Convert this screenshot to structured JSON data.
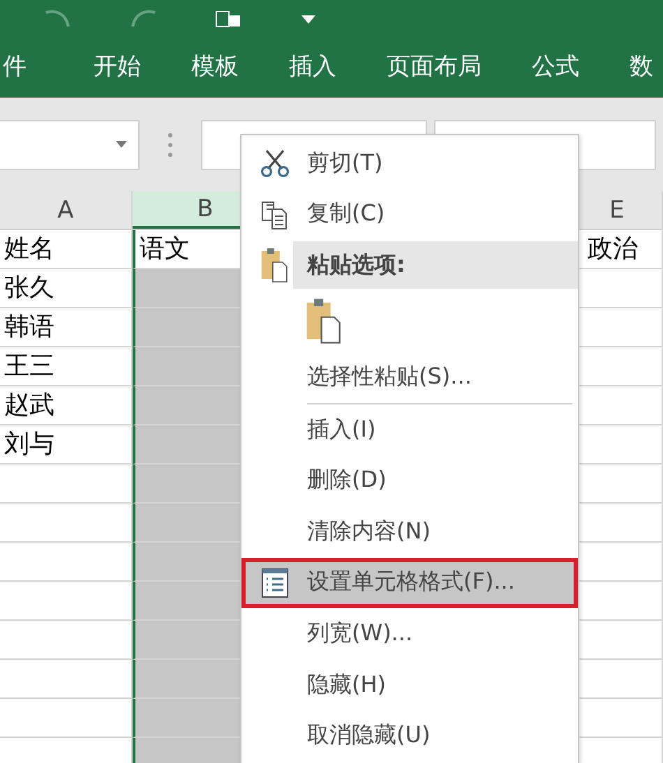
{
  "ribbon_tabs": [
    {
      "label": "件",
      "selected": false
    },
    {
      "label": "开始",
      "selected": false
    },
    {
      "label": "模板",
      "selected": false
    },
    {
      "label": "插入",
      "selected": false
    },
    {
      "label": "页面布局",
      "selected": false
    },
    {
      "label": "公式",
      "selected": false
    },
    {
      "label": "数",
      "selected": false
    }
  ],
  "sheet": {
    "columns": [
      {
        "label": "A",
        "selected": false
      },
      {
        "label": "B",
        "selected": true
      },
      {
        "label": "E",
        "selected": false
      }
    ],
    "rows": [
      [
        "姓名",
        "语文",
        "政治"
      ],
      [
        "张久"
      ],
      [
        "韩语"
      ],
      [
        "王三"
      ],
      [
        "赵武"
      ],
      [
        "刘与"
      ]
    ]
  },
  "context_menu": [
    {
      "kind": "item",
      "label": "剪切(T)",
      "selected": false
    },
    {
      "kind": "item",
      "label": "复制(C)",
      "selected": false
    },
    {
      "kind": "header",
      "label": "粘贴选项:"
    },
    {
      "kind": "paste-option"
    },
    {
      "kind": "item",
      "label": "选择性粘贴(S)...",
      "selected": false
    },
    {
      "kind": "separator"
    },
    {
      "kind": "item",
      "label": "插入(I)",
      "selected": false
    },
    {
      "kind": "item",
      "label": "删除(D)",
      "selected": false
    },
    {
      "kind": "item",
      "label": "清除内容(N)",
      "selected": false
    },
    {
      "kind": "item",
      "label": "设置单元格格式(F)...",
      "selected": true,
      "outlined": true
    },
    {
      "kind": "item",
      "label": "列宽(W)...",
      "selected": false
    },
    {
      "kind": "item",
      "label": "隐藏(H)",
      "selected": false
    },
    {
      "kind": "item",
      "label": "取消隐藏(U)",
      "selected": false
    }
  ]
}
